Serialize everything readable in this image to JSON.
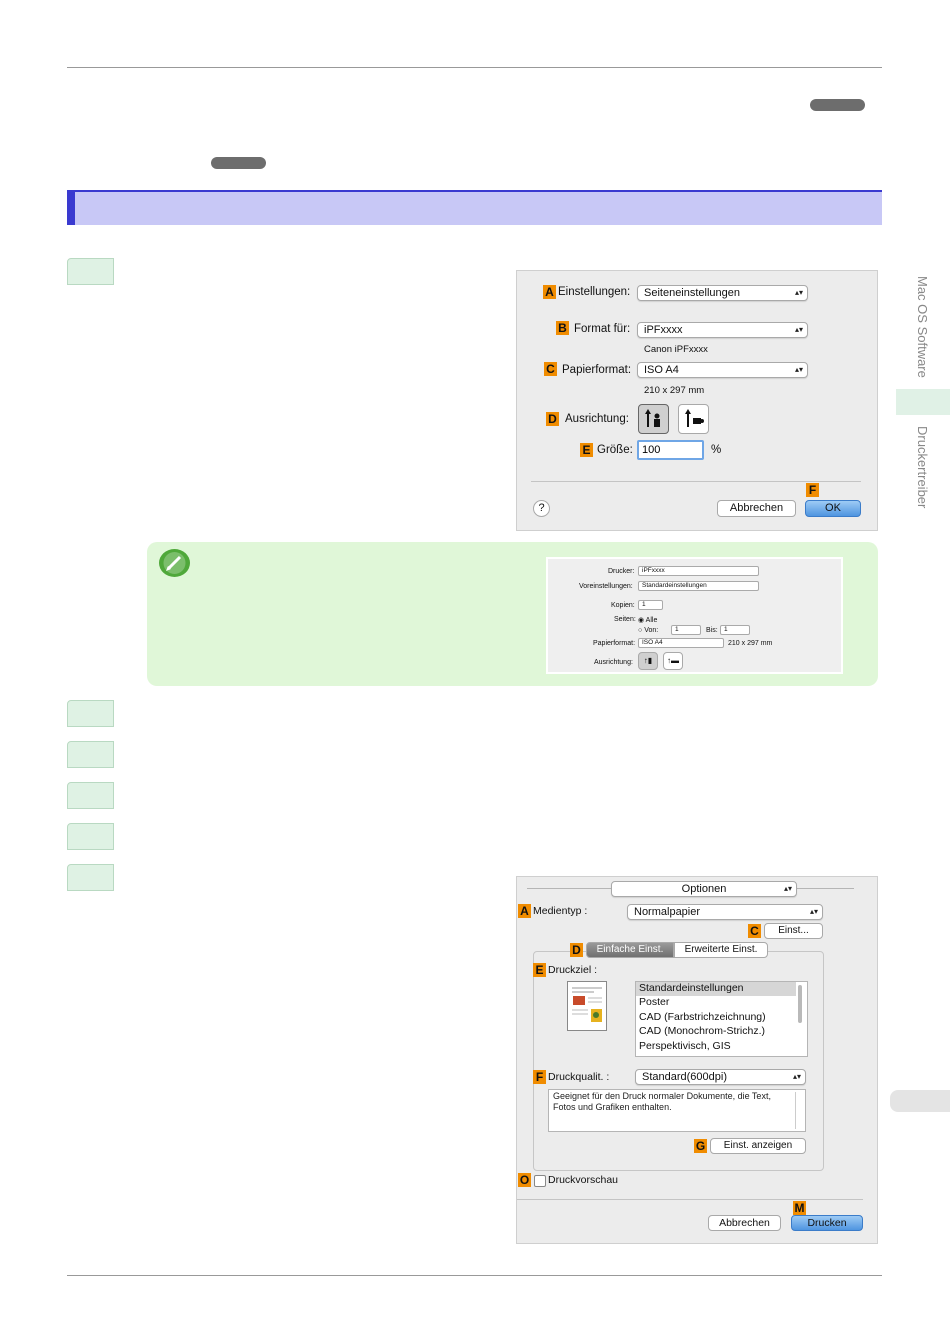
{
  "sidebar": {
    "section_1": "Mac OS Software",
    "section_2": "Druckertreiber"
  },
  "dialog1": {
    "einstellungen_label": "Einstellungen:",
    "einstellungen_value": "Seiteneinstellungen",
    "format_label": "Format für:",
    "format_value": "iPFxxxx",
    "format_sub": "Canon iPFxxxx",
    "papierformat_label": "Papierformat:",
    "papierformat_value": "ISO A4",
    "papierformat_sub": "210 x 297 mm",
    "ausrichtung_label": "Ausrichtung:",
    "groesse_label": "Größe:",
    "groesse_value": "100",
    "percent": "%",
    "help": "?",
    "cancel": "Abbrechen",
    "ok": "OK",
    "badges": [
      "A",
      "B",
      "C",
      "D",
      "E",
      "F"
    ]
  },
  "note_dialog": {
    "drucker_label": "Drucker:",
    "drucker_value": "iPFxxxx",
    "voreinstellungen_label": "Voreinstellungen:",
    "voreinstellungen_value": "Standardeinstellungen",
    "kopien_label": "Kopien:",
    "kopien_value": "1",
    "seiten_label": "Seiten:",
    "alle": "Alle",
    "von": "Von:",
    "von_value": "1",
    "bis": "Bis:",
    "bis_value": "1",
    "papierformat_label": "Papierformat:",
    "papierformat_value": "ISO A4",
    "papierformat_size": "210 x 297 mm",
    "ausrichtung_label": "Ausrichtung:"
  },
  "dialog2": {
    "optionen": "Optionen",
    "medientyp_label": "Medientyp :",
    "medientyp_value": "Normalpapier",
    "einst_button": "Einst...",
    "tab_simple": "Einfache Einst.",
    "tab_advanced": "Erweiterte Einst.",
    "druckziel_label": "Druckziel :",
    "druckziel_items": [
      "Standardeinstellungen",
      "Poster",
      "CAD (Farbstrichzeichnung)",
      "CAD (Monochrom-Strichz.)",
      "Perspektivisch, GIS"
    ],
    "druckqualit_label": "Druckqualit. :",
    "druckqualit_value": "Standard(600dpi)",
    "description": "Geeignet für den Druck normaler Dokumente, die Text, Fotos und Grafiken enthalten.",
    "einst_anzeigen": "Einst. anzeigen",
    "druckvorschau": "Druckvorschau",
    "cancel": "Abbrechen",
    "drucken": "Drucken",
    "badges": [
      "A",
      "C",
      "D",
      "E",
      "F",
      "G",
      "O",
      "M"
    ]
  }
}
